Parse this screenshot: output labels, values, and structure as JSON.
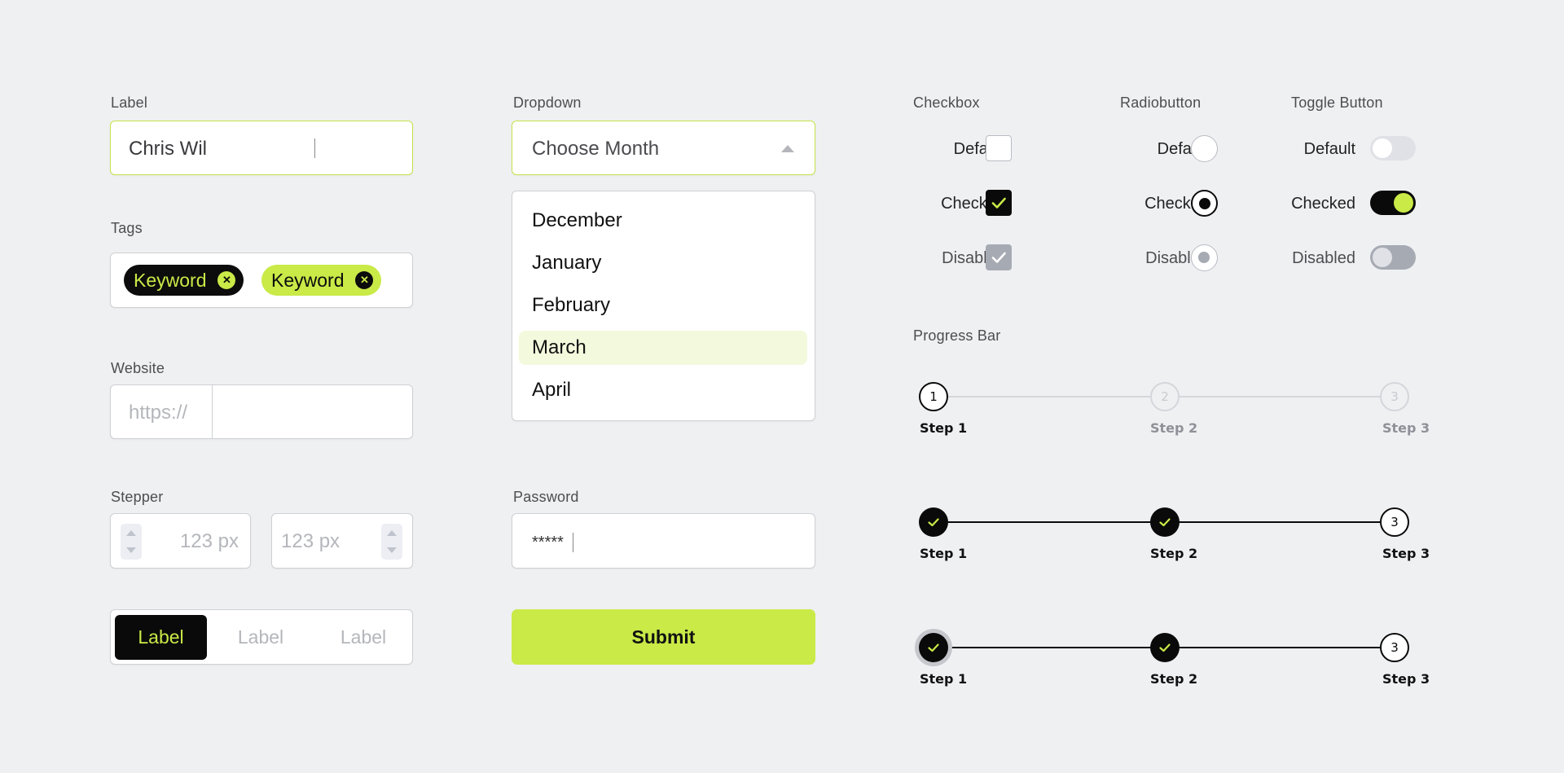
{
  "text_field": {
    "label": "Label",
    "value": "Chris Wil"
  },
  "tags": {
    "label": "Tags",
    "items": [
      {
        "text": "Keyword",
        "style": "dark"
      },
      {
        "text": "Keyword",
        "style": "lime"
      }
    ]
  },
  "website": {
    "label": "Website",
    "prefix": "https://",
    "value": ""
  },
  "stepper": {
    "label": "Stepper",
    "left_value": "123 px",
    "right_value": "123 px"
  },
  "segmented": {
    "options": [
      "Label",
      "Label",
      "Label"
    ],
    "active_index": 0
  },
  "dropdown": {
    "label": "Dropdown",
    "placeholder": "Choose Month",
    "options": [
      "December",
      "January",
      "February",
      "March",
      "April"
    ],
    "selected": "March"
  },
  "password": {
    "label": "Password",
    "value": "*****"
  },
  "submit": {
    "label": "Submit"
  },
  "checkbox": {
    "title": "Checkbox",
    "states": [
      "Default",
      "Checked",
      "Disabled"
    ]
  },
  "radio": {
    "title": "Radiobutton",
    "states": [
      "Default",
      "Checked",
      "Disabled"
    ]
  },
  "toggle": {
    "title": "Toggle Button",
    "states": [
      "Default",
      "Checked",
      "Disabled"
    ]
  },
  "progress": {
    "title": "Progress Bar",
    "rows": [
      {
        "steps": [
          {
            "label": "Step 1",
            "mark": "1",
            "state": "current"
          },
          {
            "label": "Step 2",
            "mark": "2",
            "state": "pending"
          },
          {
            "label": "Step 3",
            "mark": "3",
            "state": "pending"
          }
        ]
      },
      {
        "steps": [
          {
            "label": "Step 1",
            "mark": "check",
            "state": "done"
          },
          {
            "label": "Step 2",
            "mark": "check",
            "state": "done"
          },
          {
            "label": "Step 3",
            "mark": "3",
            "state": "current"
          }
        ]
      },
      {
        "steps": [
          {
            "label": "Step 1",
            "mark": "check",
            "state": "done-focus"
          },
          {
            "label": "Step 2",
            "mark": "check",
            "state": "done"
          },
          {
            "label": "Step 3",
            "mark": "3",
            "state": "current"
          }
        ]
      }
    ]
  },
  "colors": {
    "accent": "#c9ea47",
    "dark": "#0a0a0a",
    "muted": "#b4b6bb",
    "disabled": "#a6aab3"
  }
}
